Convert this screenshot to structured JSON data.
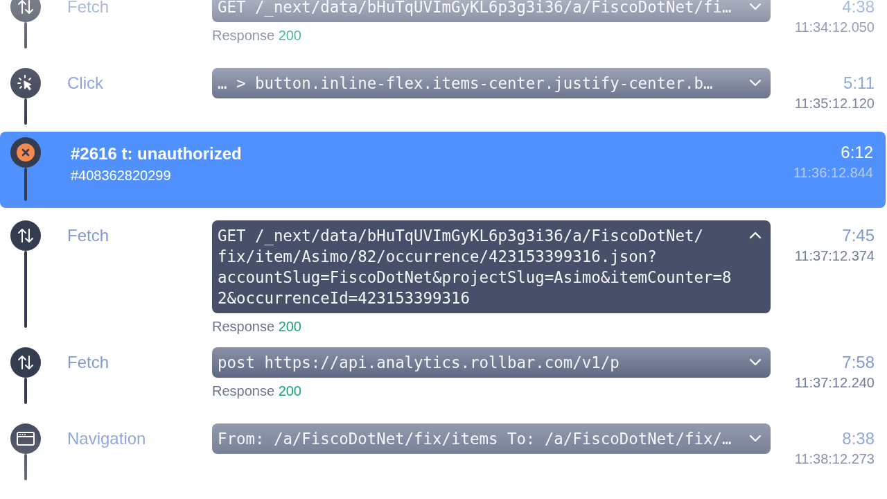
{
  "events": [
    {
      "kind": "fetch",
      "label": "Fetch",
      "code": "GET /_next/data/bHuTqUVImGyKL6p3g3i36/a/FiscoDotNet/fi…",
      "expanded": false,
      "response": {
        "label": "Response",
        "status": "200"
      },
      "duration": "4:38",
      "timestamp": "11:34:12.050",
      "selected": false
    },
    {
      "kind": "click",
      "label": "Click",
      "code": "… > button.inline-flex.items-center.justify-center.b…",
      "expanded": false,
      "duration": "5:11",
      "timestamp": "11:35:12.120",
      "selected": false
    },
    {
      "kind": "error",
      "title": "#2616 t: unauthorized",
      "subtitle": "#408362820299",
      "duration": "6:12",
      "timestamp": "11:36:12.844",
      "selected": true
    },
    {
      "kind": "fetch",
      "label": "Fetch",
      "code": "GET /_next/data/bHuTqUVImGyKL6p3g3i36/a/FiscoDotNet/fix/item/Asimo/82/occurrence/423153399316.json?accountSlug=FiscoDotNet&projectSlug=Asimo&itemCounter=82&occurrenceId=423153399316",
      "expanded": true,
      "response": {
        "label": "Response",
        "status": "200"
      },
      "duration": "7:45",
      "timestamp": "11:37:12.374",
      "selected": false
    },
    {
      "kind": "fetch",
      "label": "Fetch",
      "code": "post https://api.analytics.rollbar.com/v1/p",
      "expanded": false,
      "response": {
        "label": "Response",
        "status": "200"
      },
      "duration": "7:58",
      "timestamp": "11:37:12.240",
      "selected": false
    },
    {
      "kind": "navigation",
      "label": "Navigation",
      "code": "From: /a/FiscoDotNet/fix/items To: /a/FiscoDotNet/fix/…",
      "expanded": false,
      "duration": "8:38",
      "timestamp": "11:38:12.273",
      "selected": false
    }
  ]
}
